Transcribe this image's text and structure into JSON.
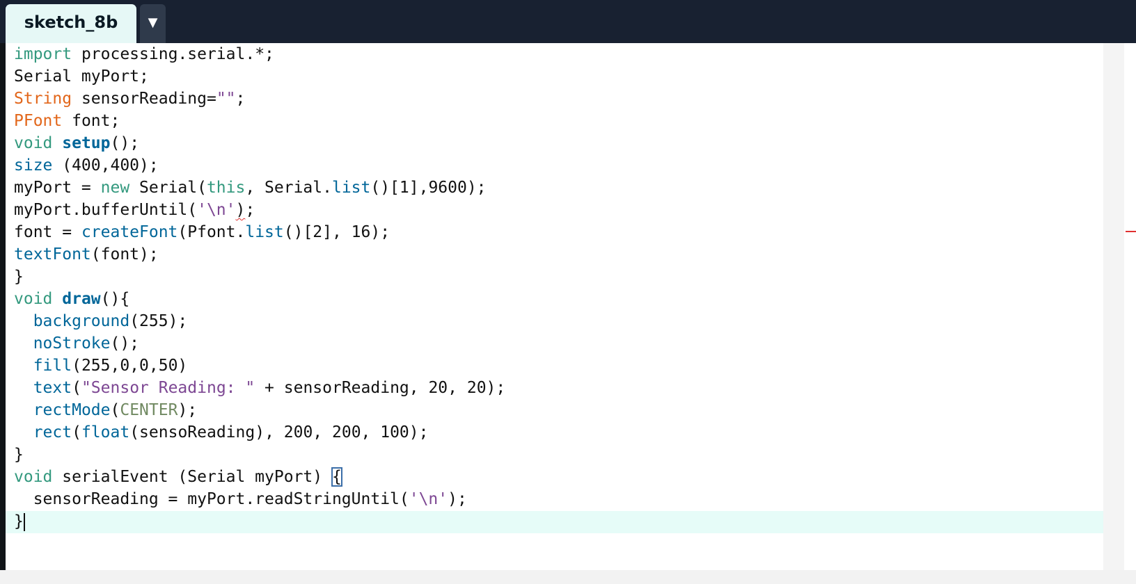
{
  "tab": {
    "name": "sketch_8b",
    "menu_glyph": "▼"
  },
  "editor": {
    "lines": [
      [
        {
          "t": "import",
          "c": "kw-import"
        },
        {
          "t": " processing.serial.*;",
          "c": "plain"
        }
      ],
      [
        {
          "t": "Serial myPort;",
          "c": "plain"
        }
      ],
      [
        {
          "t": "String",
          "c": "kw-type"
        },
        {
          "t": " sensorReading=",
          "c": "plain"
        },
        {
          "t": "\"\"",
          "c": "str"
        },
        {
          "t": ";",
          "c": "plain"
        }
      ],
      [
        {
          "t": "PFont",
          "c": "kw-type"
        },
        {
          "t": " font;",
          "c": "plain"
        }
      ],
      [
        {
          "t": "void",
          "c": "kw-void"
        },
        {
          "t": " ",
          "c": "plain"
        },
        {
          "t": "setup",
          "c": "fn-def"
        },
        {
          "t": "();",
          "c": "plain"
        }
      ],
      [
        {
          "t": "size",
          "c": "fn"
        },
        {
          "t": " (400,400);",
          "c": "plain"
        }
      ],
      [
        {
          "t": "myPort = ",
          "c": "plain"
        },
        {
          "t": "new",
          "c": "kw-new"
        },
        {
          "t": " Serial(",
          "c": "plain"
        },
        {
          "t": "this",
          "c": "kw-new"
        },
        {
          "t": ", Serial.",
          "c": "plain"
        },
        {
          "t": "list",
          "c": "fn"
        },
        {
          "t": "()[1],9600);",
          "c": "plain"
        }
      ],
      [
        {
          "t": "myPort.bufferUntil(",
          "c": "plain"
        },
        {
          "t": "'\\n'",
          "c": "str"
        },
        {
          "t": ")",
          "c": "plain squiggle"
        },
        {
          "t": ";",
          "c": "plain"
        }
      ],
      [
        {
          "t": "font = ",
          "c": "plain"
        },
        {
          "t": "createFont",
          "c": "fn"
        },
        {
          "t": "(Pfont.",
          "c": "plain"
        },
        {
          "t": "list",
          "c": "fn"
        },
        {
          "t": "()[2], 16);",
          "c": "plain"
        }
      ],
      [
        {
          "t": "textFont",
          "c": "fn"
        },
        {
          "t": "(font);",
          "c": "plain"
        }
      ],
      [
        {
          "t": "}",
          "c": "plain"
        }
      ],
      [
        {
          "t": "void",
          "c": "kw-void"
        },
        {
          "t": " ",
          "c": "plain"
        },
        {
          "t": "draw",
          "c": "fn-def"
        },
        {
          "t": "(){",
          "c": "plain"
        }
      ],
      [
        {
          "t": "  ",
          "c": "plain"
        },
        {
          "t": "background",
          "c": "fn"
        },
        {
          "t": "(255);",
          "c": "plain"
        }
      ],
      [
        {
          "t": "  ",
          "c": "plain"
        },
        {
          "t": "noStroke",
          "c": "fn"
        },
        {
          "t": "();",
          "c": "plain"
        }
      ],
      [
        {
          "t": "  ",
          "c": "plain"
        },
        {
          "t": "fill",
          "c": "fn"
        },
        {
          "t": "(255,0,0,50)",
          "c": "plain"
        }
      ],
      [
        {
          "t": "  ",
          "c": "plain"
        },
        {
          "t": "text",
          "c": "fn"
        },
        {
          "t": "(",
          "c": "plain"
        },
        {
          "t": "\"Sensor Reading: \"",
          "c": "str"
        },
        {
          "t": " + sensorReading, 20, 20);",
          "c": "plain"
        }
      ],
      [
        {
          "t": "  ",
          "c": "plain"
        },
        {
          "t": "rectMode",
          "c": "fn"
        },
        {
          "t": "(",
          "c": "plain"
        },
        {
          "t": "CENTER",
          "c": "const"
        },
        {
          "t": ");",
          "c": "plain"
        }
      ],
      [
        {
          "t": "  ",
          "c": "plain"
        },
        {
          "t": "rect",
          "c": "fn"
        },
        {
          "t": "(",
          "c": "plain"
        },
        {
          "t": "float",
          "c": "fn"
        },
        {
          "t": "(sensoReading), 200, 200, 100);",
          "c": "plain"
        }
      ],
      [
        {
          "t": "}",
          "c": "plain"
        }
      ],
      [
        {
          "t": "void",
          "c": "kw-void"
        },
        {
          "t": " serialEvent (Serial myPort) ",
          "c": "plain"
        },
        {
          "t": "{",
          "c": "plain bracket-hl"
        }
      ],
      [
        {
          "t": "  sensorReading = myPort.readStringUntil(",
          "c": "plain"
        },
        {
          "t": "'\\n'",
          "c": "str"
        },
        {
          "t": ");",
          "c": "plain"
        }
      ],
      [
        {
          "t": "}",
          "c": "plain"
        }
      ]
    ]
  },
  "colors": {
    "background_dark": "#182131",
    "tab_active": "#e6f8f6",
    "current_line": "#e6fcf8",
    "keyword_green": "#33997e",
    "type_orange": "#e2661a",
    "function_blue": "#006699",
    "string_purple": "#7d4793",
    "constant_olive": "#718a62",
    "error_red": "#e03030"
  }
}
